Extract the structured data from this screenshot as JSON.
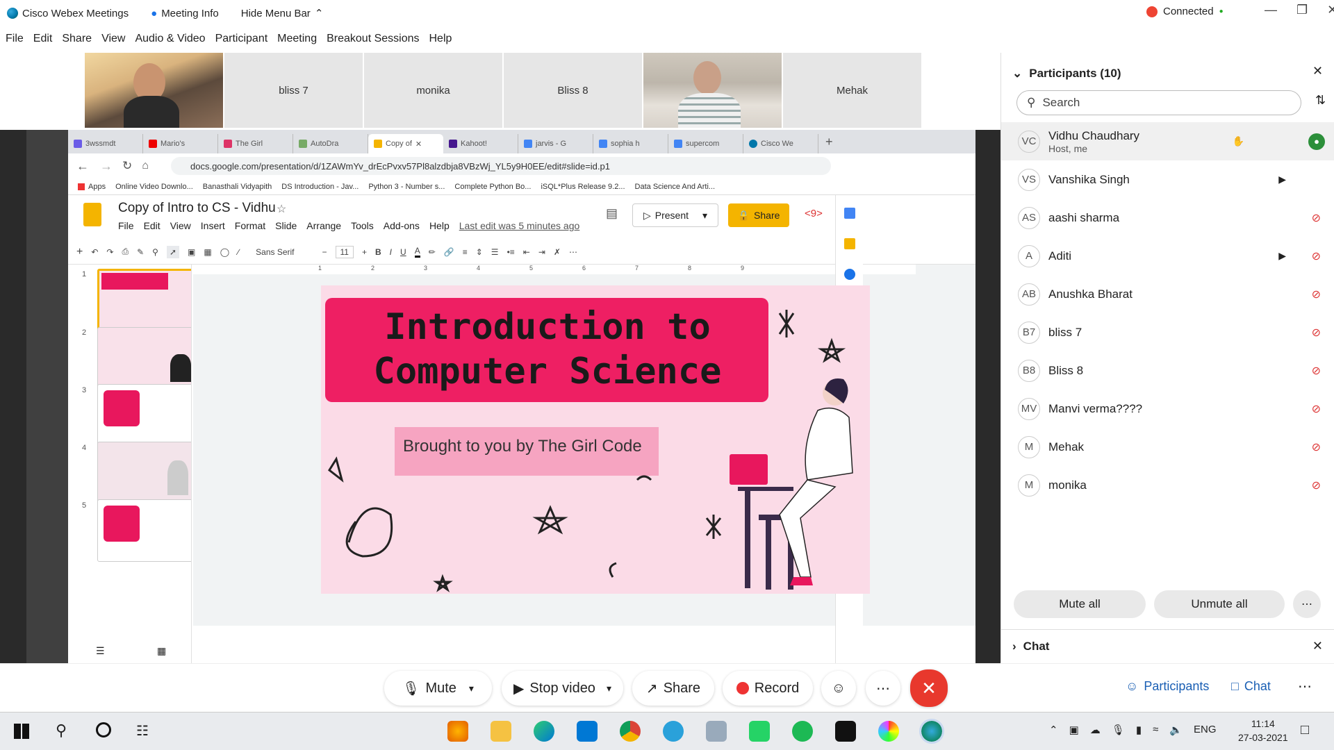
{
  "titlebar": {
    "app": "Cisco Webex Meetings",
    "meeting_info": "Meeting Info",
    "hide_menu": "Hide Menu Bar",
    "status": "Connected"
  },
  "menubar": [
    "File",
    "Edit",
    "Share",
    "View",
    "Audio & Video",
    "Participant",
    "Meeting",
    "Breakout Sessions",
    "Help"
  ],
  "video_thumbs": [
    "",
    "bliss 7",
    "monika",
    "Bliss 8",
    "",
    "Mehak"
  ],
  "browser": {
    "tabs": [
      "3wssmdt",
      "Mario's",
      "The Girl",
      "AutoDra",
      "Copy of",
      "Kahoot!",
      "jarvis - G",
      "sophia h",
      "supercom",
      "Cisco We"
    ],
    "url": "docs.google.com/presentation/d/1ZAWmYv_drEcPvxv57Pl8alzdbja8VBzWj_YL5y9H0EE/edit#slide=id.p1",
    "bookmarks": [
      "Apps",
      "Online Video Downlo...",
      "Banasthali Vidyapith",
      "DS Introduction - Jav...",
      "Python 3 - Number s...",
      "Complete Python Bo...",
      "iSQL*Plus Release 9.2...",
      "Data Science And Arti..."
    ]
  },
  "doc": {
    "title": "Copy of Intro to CS - Vidhu",
    "menu": [
      "File",
      "Edit",
      "View",
      "Insert",
      "Format",
      "Slide",
      "Arrange",
      "Tools",
      "Add-ons",
      "Help"
    ],
    "last_edit": "Last edit was 5 minutes ago",
    "present": "Present",
    "share": "Share",
    "font": "Sans Serif",
    "font_size": "11",
    "ruler": [
      "1",
      "2",
      "3",
      "4",
      "5",
      "6",
      "7",
      "8",
      "9"
    ],
    "film_numbers": [
      "1",
      "2",
      "3",
      "4",
      "5"
    ]
  },
  "slide": {
    "title_line1": "Introduction to",
    "title_line2": "Computer Science",
    "subtitle": "Brought to you by The Girl Code"
  },
  "participants": {
    "header": "Participants (10)",
    "search_placeholder": "Search",
    "list": [
      {
        "initials": "VC",
        "name": "Vidhu Chaudhary",
        "role": "Host, me"
      },
      {
        "initials": "VS",
        "name": "Vanshika Singh",
        "role": ""
      },
      {
        "initials": "AS",
        "name": "aashi sharma",
        "role": ""
      },
      {
        "initials": "A",
        "name": "Aditi",
        "role": ""
      },
      {
        "initials": "AB",
        "name": "Anushka Bharat",
        "role": ""
      },
      {
        "initials": "B7",
        "name": "bliss 7",
        "role": ""
      },
      {
        "initials": "B8",
        "name": "Bliss 8",
        "role": ""
      },
      {
        "initials": "MV",
        "name": "Manvi verma????",
        "role": ""
      },
      {
        "initials": "M",
        "name": "Mehak",
        "role": ""
      },
      {
        "initials": "M",
        "name": "monika",
        "role": ""
      }
    ],
    "mute_all": "Mute all",
    "unmute_all": "Unmute all",
    "chat": "Chat"
  },
  "controls": {
    "mute": "Mute",
    "stop_video": "Stop video",
    "share": "Share",
    "record": "Record",
    "participants": "Participants",
    "chat": "Chat"
  },
  "taskbar": {
    "lang": "ENG",
    "time": "11:14",
    "date": "27-03-2021"
  }
}
